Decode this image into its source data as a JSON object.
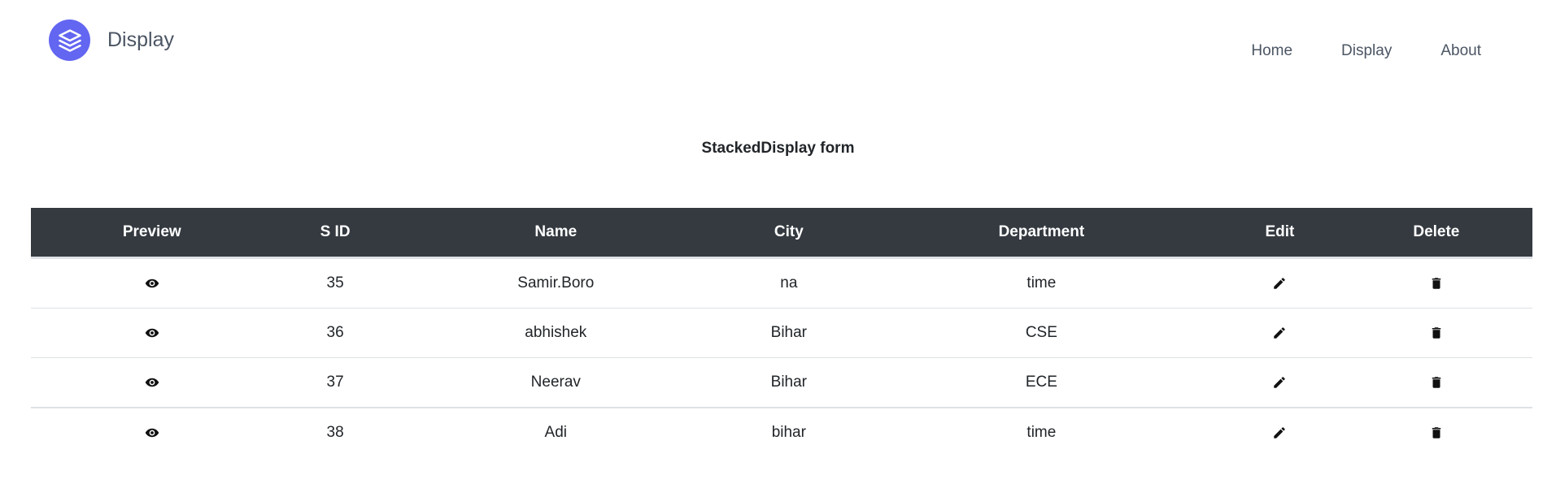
{
  "brand": {
    "name": "Display",
    "logo_icon": "layers-icon",
    "logo_color": "#6366f1"
  },
  "nav": {
    "items": [
      {
        "label": "Home"
      },
      {
        "label": "Display"
      },
      {
        "label": "About"
      }
    ]
  },
  "page": {
    "title": "StackedDisplay form"
  },
  "table": {
    "header_bg": "#343a40",
    "columns": [
      "Preview",
      "S ID",
      "Name",
      "City",
      "Department",
      "Edit",
      "Delete"
    ],
    "rows": [
      {
        "sid": "35",
        "name": "Samir.Boro",
        "city": "na",
        "department": "time"
      },
      {
        "sid": "36",
        "name": "abhishek",
        "city": "Bihar",
        "department": "CSE"
      },
      {
        "sid": "37",
        "name": "Neerav",
        "city": "Bihar",
        "department": "ECE"
      },
      {
        "sid": "38",
        "name": "Adi",
        "city": "bihar",
        "department": "time"
      }
    ],
    "icons": {
      "preview": "eye-icon",
      "edit": "pencil-icon",
      "delete": "trash-icon"
    }
  }
}
